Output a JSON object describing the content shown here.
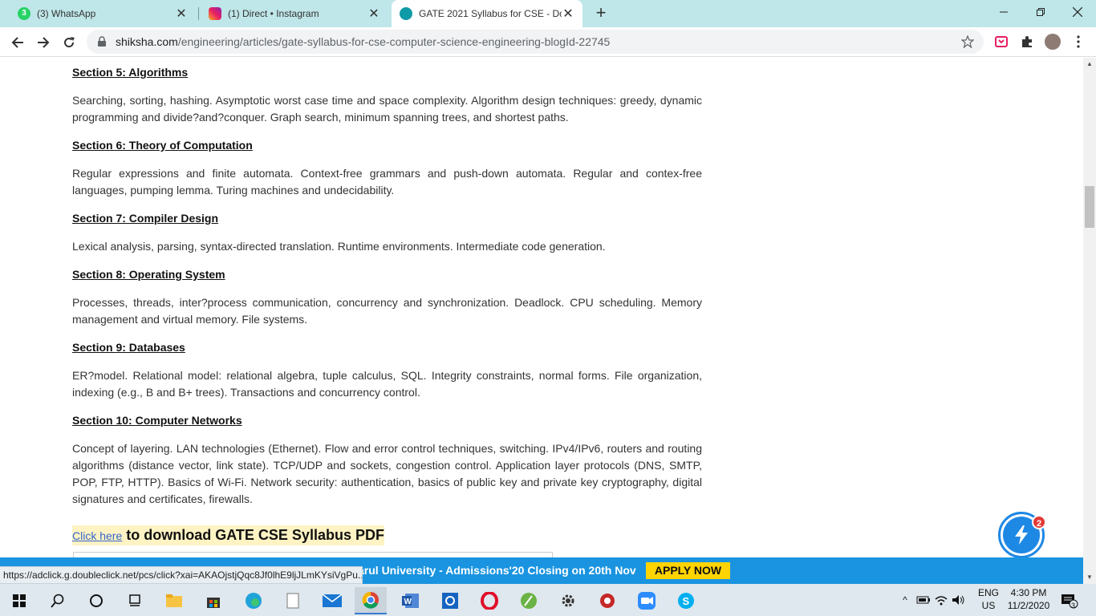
{
  "browser": {
    "tabs": [
      {
        "title": "(3) WhatsApp",
        "badge": "3"
      },
      {
        "title": "(1) Direct • Instagram"
      },
      {
        "title": "GATE 2021 Syllabus for CSE - Do"
      }
    ],
    "url_domain": "shiksha.com",
    "url_path": "/engineering/articles/gate-syllabus-for-cse-computer-science-engineering-blogId-22745"
  },
  "article": {
    "sections": [
      {
        "heading": "Section 5: Algorithms",
        "body": "Searching, sorting, hashing. Asymptotic worst case time and space complexity. Algorithm design techniques: greedy, dynamic programming and divide?and?conquer. Graph search, minimum spanning trees, and shortest paths."
      },
      {
        "heading": "Section 6: Theory of Computation",
        "body": "Regular expressions and finite automata. Context-free grammars and push-down automata. Regular and contex-free languages, pumping lemma. Turing machines and undecidability."
      },
      {
        "heading": "Section 7: Compiler Design",
        "body": "Lexical analysis, parsing, syntax-directed translation. Runtime environments. Intermediate code generation."
      },
      {
        "heading": "Section 8: Operating System",
        "body": "Processes, threads, inter?process communication, concurrency and synchronization. Deadlock. CPU scheduling. Memory management and virtual memory. File systems."
      },
      {
        "heading": "Section 9: Databases",
        "body": "ER?model. Relational model: relational algebra, tuple calculus, SQL. Integrity constraints, normal forms. File organization, indexing (e.g., B and B+ trees). Transactions and concurrency control."
      },
      {
        "heading": "Section 10: Computer Networks",
        "body": "Concept of layering. LAN technologies (Ethernet). Flow and error control techniques, switching. IPv4/IPv6, routers and routing algorithms (distance vector, link state). TCP/UDP and sockets, congestion control. Application layer protocols (DNS, SMTP, POP, FTP, HTTP). Basics of Wi-Fi. Network security: authentication, basics of public key and private key cryptography, digital signatures and certificates, firewalls."
      }
    ],
    "download_link": "Click here",
    "download_text": "to download GATE CSE Syllabus PDF"
  },
  "chat_widget": {
    "badge": "2"
  },
  "ad": {
    "text": "arul University - Admissions'20 Closing on 20th Nov",
    "cta": "APPLY NOW"
  },
  "status_url": "https://adclick.g.doubleclick.net/pcs/click?xai=AKAOjstjQqc8Jf0lhE9ljJLmKYsiVgPu...",
  "taskbar": {
    "lang_top": "ENG",
    "lang_bottom": "US",
    "time": "4:30 PM",
    "date": "11/2/2020",
    "notif_count": "3"
  },
  "colors": {
    "tabstrip": "#bfe6e8",
    "ad_bg": "#1a94e0",
    "apply_bg": "#ffd400",
    "highlight": "#fff3c4"
  }
}
